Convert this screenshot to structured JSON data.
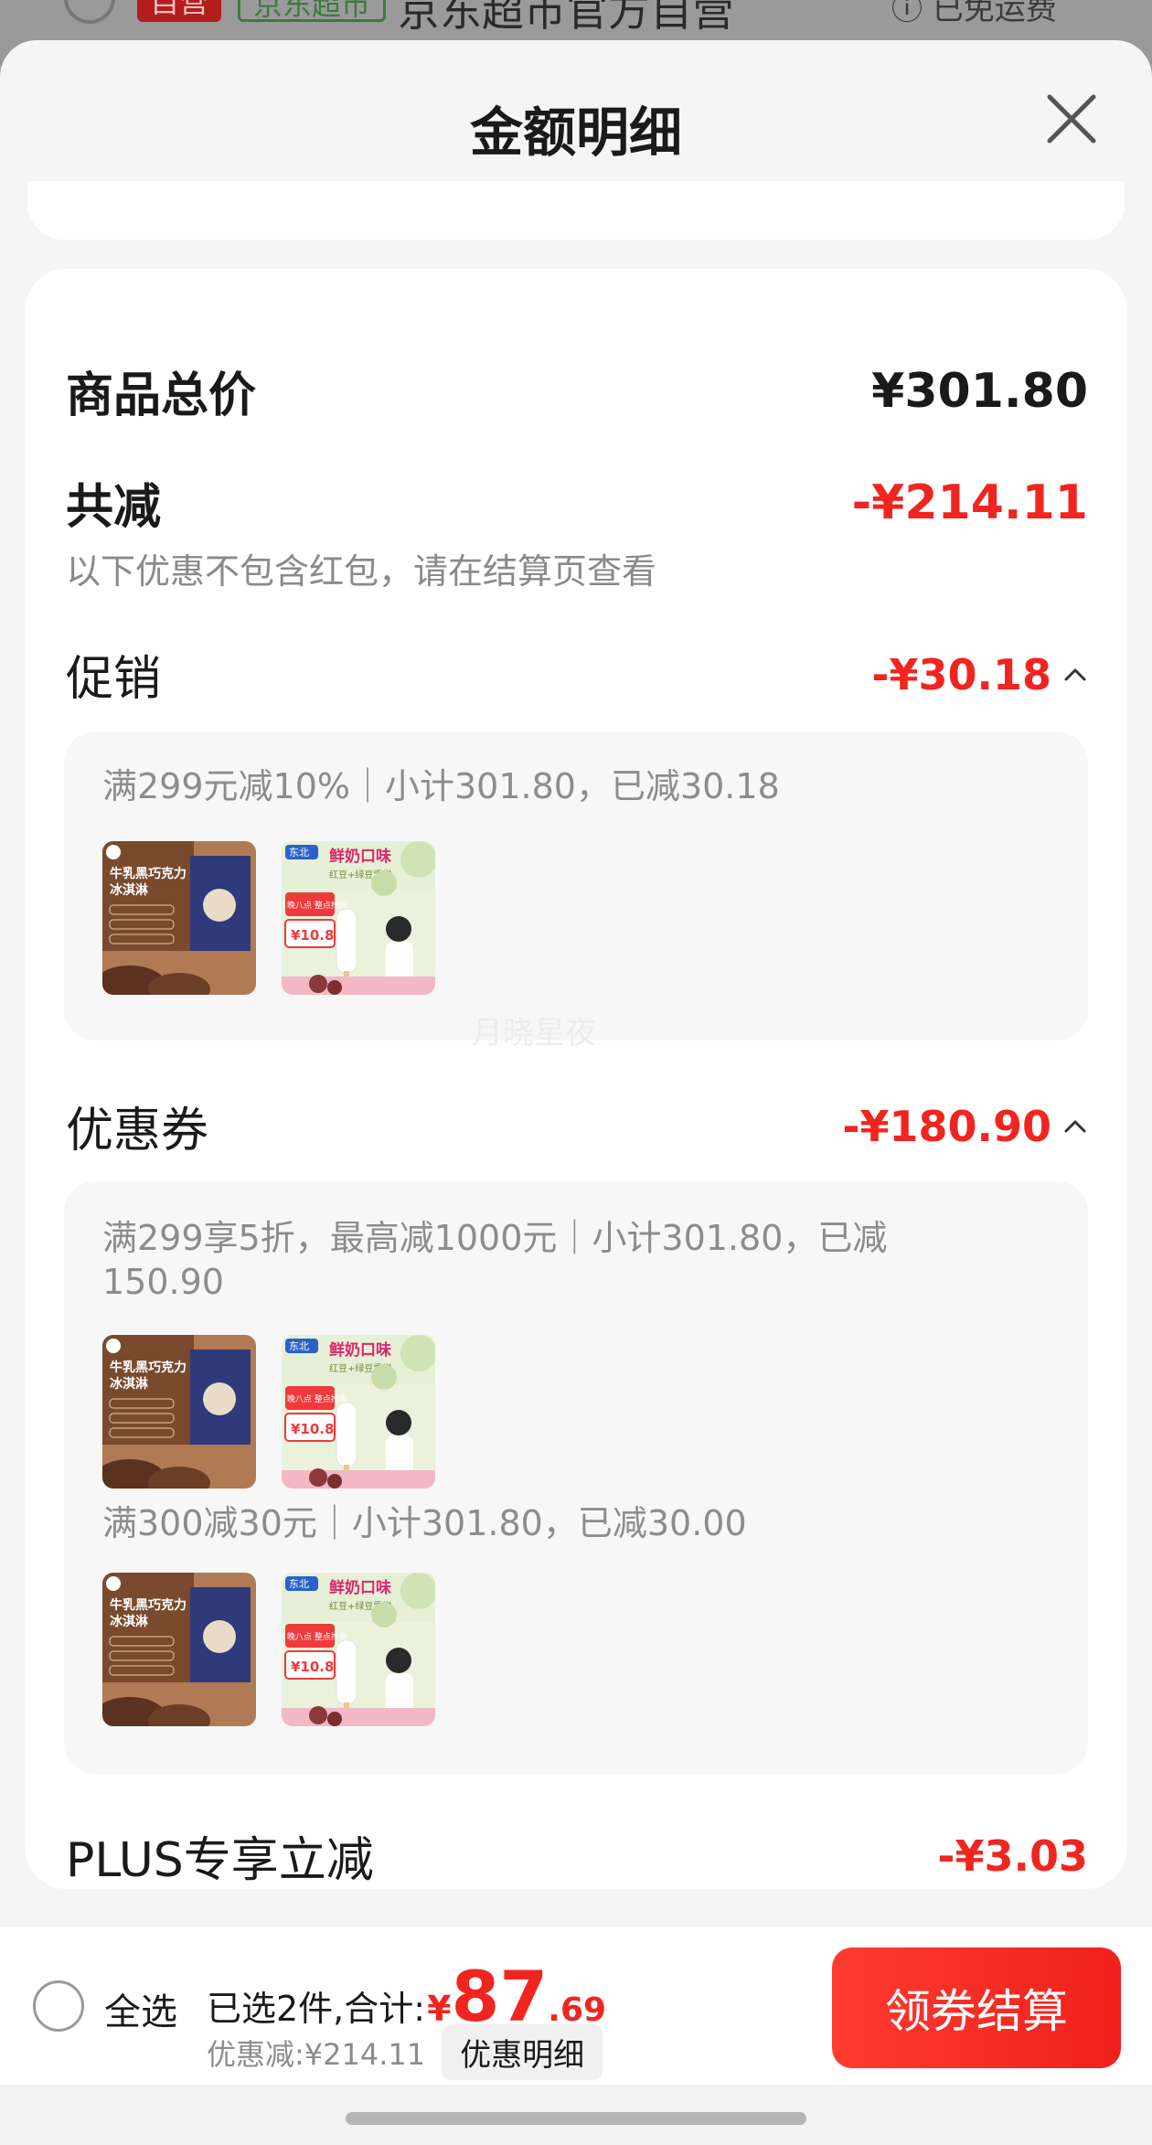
{
  "behind": {
    "badge_self": "自营",
    "badge_market": "京东超市",
    "shop_name": "京东超市官方自营",
    "shipping": "ⓘ 已免运费"
  },
  "sheet": {
    "title": "金额明细"
  },
  "breakdown": {
    "total_label": "商品总价",
    "total_value": "¥301.80",
    "reduce_label": "共减",
    "reduce_value": "-¥214.11",
    "reduce_note": "以下优惠不包含红包，请在结算页查看",
    "promo": {
      "label": "促销",
      "value": "-¥30.18",
      "detail": "满299元减10%｜小计301.80，已减30.18"
    },
    "coupon": {
      "label": "优惠券",
      "value": "-¥180.90",
      "detail_1": "满299享5折，最高减1000元｜小计301.80，已减150.90",
      "detail_2": "满300减30元｜小计301.80，已减30.00"
    },
    "plus": {
      "label": "PLUS专享立减",
      "value": "-¥3.03"
    }
  },
  "products": {
    "choc": {
      "line1": "牛乳黑巧克力",
      "line2": "冰淇淋"
    },
    "milk": {
      "brand": "东北",
      "title": "鲜奶口味",
      "subtitle": "红豆+绿豆雪糕",
      "promo": "晚八点 整点抢购",
      "price": "10.8"
    }
  },
  "watermark": "月晓星夜",
  "bottom": {
    "select_all": "全选",
    "selected_text": "已选2件,合计:",
    "currency": "¥",
    "total_int": "87",
    "total_dec": ".69",
    "discount_text": "优惠减:¥214.11",
    "detail_button": "优惠明细",
    "checkout": "领券结算"
  },
  "colors": {
    "accent": "#f0251f",
    "sheet_bg": "#f5f5f5",
    "card_bg": "#ffffff",
    "muted": "#8c8c8c"
  }
}
